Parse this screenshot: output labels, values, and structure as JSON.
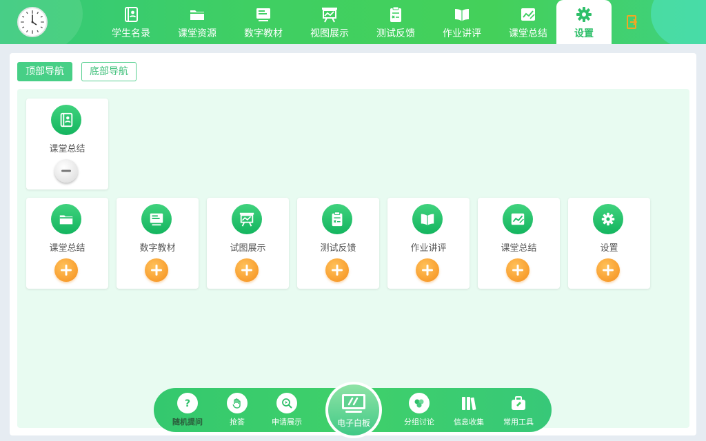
{
  "top_nav": {
    "items": [
      {
        "label": "学生名录",
        "icon": "contacts-book-icon"
      },
      {
        "label": "课堂资源",
        "icon": "folder-icon"
      },
      {
        "label": "数字教材",
        "icon": "textbook-icon"
      },
      {
        "label": "视图展示",
        "icon": "display-board-icon"
      },
      {
        "label": "测试反馈",
        "icon": "test-clipboard-icon"
      },
      {
        "label": "作业讲评",
        "icon": "open-book-icon"
      },
      {
        "label": "课堂总结",
        "icon": "chart-summary-icon"
      },
      {
        "label": "设置",
        "icon": "gear-icon",
        "active": true
      }
    ],
    "exit_icon": "exit-door-icon"
  },
  "tabs": {
    "top": "顶部导航",
    "bottom": "底部导航",
    "selected": "顶部导航"
  },
  "selected_cards": [
    {
      "label": "课堂总结",
      "icon": "contacts-book-icon",
      "action": "remove"
    }
  ],
  "available_cards": [
    {
      "label": "课堂总结",
      "icon": "folder-icon",
      "action": "add"
    },
    {
      "label": "数字教材",
      "icon": "textbook-icon",
      "action": "add"
    },
    {
      "label": "试图展示",
      "icon": "display-board-icon",
      "action": "add"
    },
    {
      "label": "测试反馈",
      "icon": "test-clipboard-icon",
      "action": "add"
    },
    {
      "label": "作业讲评",
      "icon": "open-book-icon",
      "action": "add"
    },
    {
      "label": "课堂总结",
      "icon": "chart-summary-icon",
      "action": "add"
    },
    {
      "label": "设置",
      "icon": "gear-icon",
      "action": "add"
    }
  ],
  "dock": {
    "items": [
      {
        "label": "随机提问",
        "icon": "question-icon"
      },
      {
        "label": "抢答",
        "icon": "hand-icon"
      },
      {
        "label": "申请展示",
        "icon": "magnify-play-icon"
      },
      {
        "label": "分组讨论",
        "icon": "group-icon"
      },
      {
        "label": "信息收集",
        "icon": "books-icon"
      },
      {
        "label": "常用工具",
        "icon": "toolbox-icon"
      }
    ],
    "center": {
      "label": "电子白板",
      "icon": "whiteboard-icon"
    }
  },
  "colors": {
    "primary_green": "#3fcf63",
    "light_green_bg": "#e8fbf1",
    "add_orange": "#f58f1c"
  }
}
